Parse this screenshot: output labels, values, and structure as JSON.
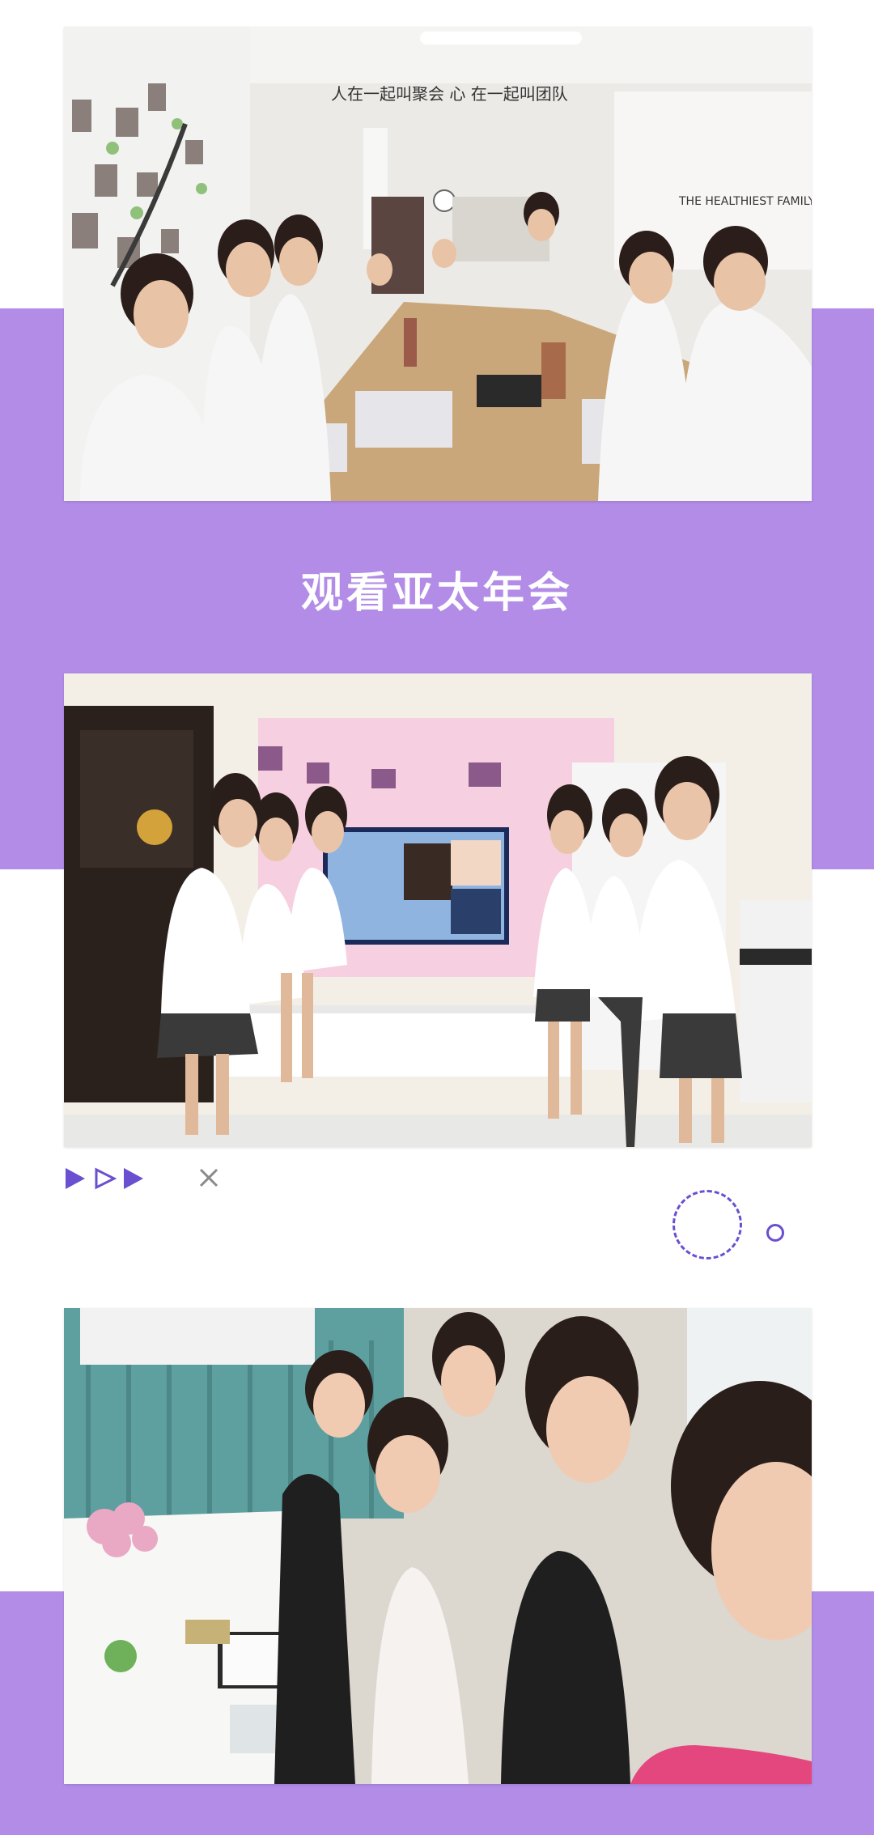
{
  "section": {
    "title": "观看亚太年会"
  },
  "photos": {
    "team_meeting": {
      "banner_text": "人在一起叫聚会 心 在一起叫团队",
      "wall_text": "THE HEALTHIEST FAMILY ON EARTH"
    },
    "tv_viewing": {},
    "group_selfie": {}
  },
  "colors": {
    "accent_band": "#b28ce6",
    "decoration": "#6a4fd0",
    "title_text": "#ffffff"
  },
  "decorations": {
    "play_icons": [
      "filled-triangle",
      "outline-triangle",
      "filled-triangle"
    ],
    "close_mark": "x-icon",
    "circles": [
      "dashed-ring",
      "small-ring"
    ]
  }
}
